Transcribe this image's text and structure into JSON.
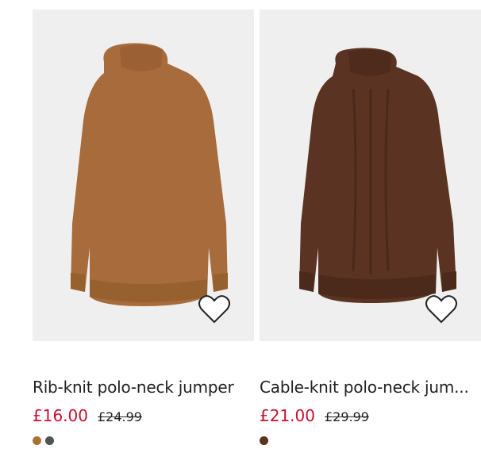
{
  "products": [
    {
      "title": "Rib-knit polo-neck jumper",
      "price_now": "£16.00",
      "price_was": "£24.99",
      "image_bg": "#efefef",
      "sweater_color": "#a86c3c",
      "swatches": [
        "#a67334",
        "#505457"
      ],
      "favorite_icon": "heart-outline-icon"
    },
    {
      "title": "Cable-knit polo-neck jum...",
      "price_now": "£21.00",
      "price_was": "£29.99",
      "image_bg": "#efefef",
      "sweater_color": "#5b3322",
      "swatches": [
        "#5a3420"
      ],
      "favorite_icon": "heart-outline-icon"
    }
  ]
}
